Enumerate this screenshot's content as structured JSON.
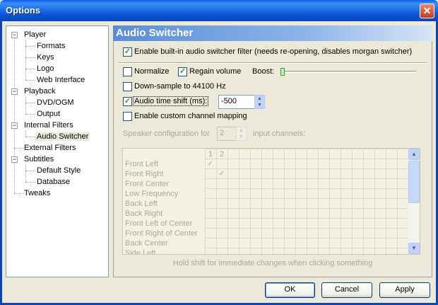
{
  "window": {
    "title": "Options"
  },
  "tree": {
    "items": [
      {
        "label": "Player"
      },
      {
        "label": "Formats"
      },
      {
        "label": "Keys"
      },
      {
        "label": "Logo"
      },
      {
        "label": "Web Interface"
      },
      {
        "label": "Playback"
      },
      {
        "label": "DVD/OGM"
      },
      {
        "label": "Output"
      },
      {
        "label": "Internal Filters"
      },
      {
        "label": "Audio Switcher",
        "selected": true
      },
      {
        "label": "External Filters"
      },
      {
        "label": "Subtitles"
      },
      {
        "label": "Default Style"
      },
      {
        "label": "Database"
      },
      {
        "label": "Tweaks"
      }
    ]
  },
  "panel": {
    "title": "Audio Switcher",
    "enable_switcher": {
      "label": "Enable built-in audio switcher filter (needs re-opening, disables morgan switcher)",
      "checked": true
    },
    "normalize": {
      "label": "Normalize",
      "checked": false
    },
    "regain": {
      "label": "Regain volume",
      "checked": true
    },
    "boost": {
      "label": "Boost:",
      "value": 0
    },
    "downsample": {
      "label": "Down-sample to 44100 Hz",
      "checked": false
    },
    "time_shift": {
      "label": "Audio time shift (ms):",
      "checked": true,
      "value": "-500"
    },
    "custom_mapping": {
      "label": "Enable custom channel mapping",
      "checked": false
    },
    "speaker_config": {
      "label_before": "Speaker configuration for",
      "value": "2",
      "label_after": "input channels:"
    },
    "mapping": {
      "columns": [
        "1",
        "2"
      ],
      "rows": [
        "Front Left",
        "Front Right",
        "Front Center",
        "Low Frequency",
        "Back Left",
        "Back Right",
        "Front Left of Center",
        "Front Right of Center",
        "Back Center",
        "Side Left"
      ],
      "checks": [
        [
          true,
          false
        ],
        [
          false,
          true
        ]
      ]
    },
    "hint": "Hold shift for immediate changes when clicking something"
  },
  "buttons": {
    "ok": "OK",
    "cancel": "Cancel",
    "apply": "Apply"
  },
  "icons": {
    "close": "close-icon",
    "check": "checkmark-icon",
    "spin_up": "spin-up-icon",
    "spin_down": "spin-down-icon",
    "expand": "collapse-icon"
  }
}
